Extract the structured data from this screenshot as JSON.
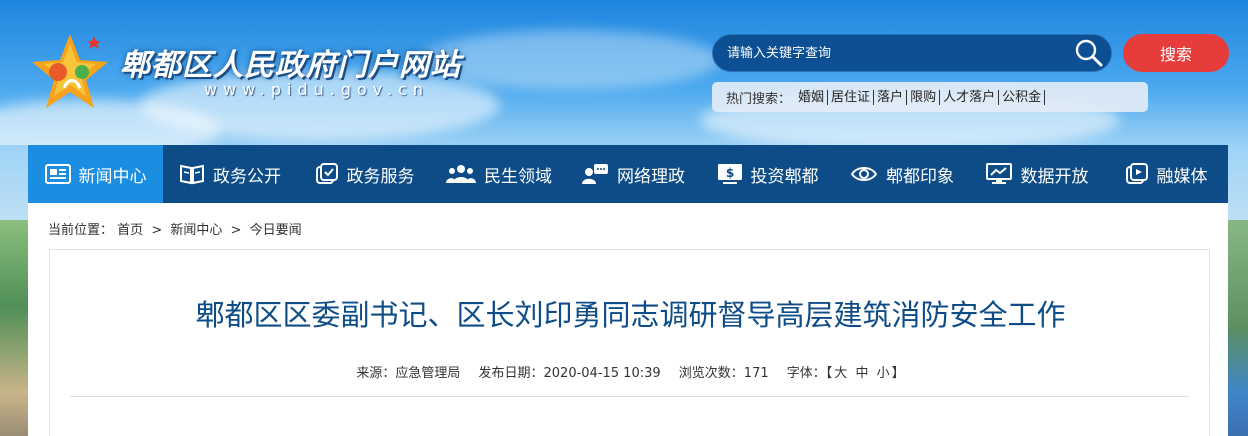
{
  "header": {
    "site_name": "郫都区人民政府门户网站",
    "site_url": "www.pidu.gov.cn"
  },
  "search": {
    "placeholder": "请输入关键字查询",
    "button_label": "搜索",
    "hot_label": "热门搜索：",
    "hot_terms": [
      "婚姻",
      "居住证",
      "落户",
      "限购",
      "人才落户",
      "公积金"
    ]
  },
  "nav": {
    "items": [
      {
        "label": "新闻中心",
        "icon": "newspaper-icon",
        "active": true
      },
      {
        "label": "政务公开",
        "icon": "book-icon"
      },
      {
        "label": "政务服务",
        "icon": "service-icon"
      },
      {
        "label": "民生领域",
        "icon": "people-icon"
      },
      {
        "label": "网络理政",
        "icon": "chat-user-icon"
      },
      {
        "label": "投资郫都",
        "icon": "dollar-icon"
      },
      {
        "label": "郫都印象",
        "icon": "eye-icon"
      },
      {
        "label": "数据开放",
        "icon": "monitor-chart-icon"
      },
      {
        "label": "融媒体",
        "icon": "media-icon"
      }
    ]
  },
  "breadcrumb": {
    "label": "当前位置：",
    "items": [
      "首页",
      "新闻中心",
      "今日要闻"
    ],
    "separator": ">"
  },
  "article": {
    "title": "郫都区区委副书记、区长刘印勇同志调研督导高层建筑消防安全工作",
    "source": "来源：应急管理局",
    "date": "发布日期：2020-04-15 10:39",
    "views": "浏览次数：171",
    "font_label": "字体：",
    "font_bracket_open": "【",
    "font_large": "大",
    "font_medium": "中",
    "font_small": "小",
    "font_bracket_close": "】"
  },
  "colors": {
    "nav_bg": "#0e4c88",
    "nav_active": "#1c8ee2",
    "search_btn": "#e63c3c",
    "title": "#0e4c88"
  }
}
